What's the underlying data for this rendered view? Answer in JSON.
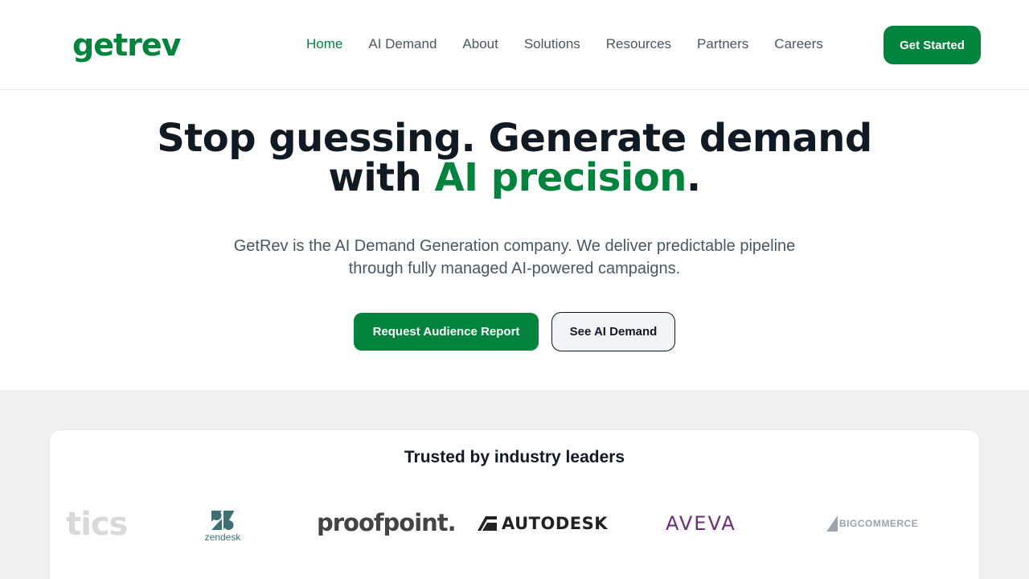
{
  "header": {
    "logo": "getrev",
    "nav": [
      {
        "label": "Home",
        "active": true
      },
      {
        "label": "AI Demand",
        "active": false
      },
      {
        "label": "About",
        "active": false
      },
      {
        "label": "Solutions",
        "active": false
      },
      {
        "label": "Resources",
        "active": false
      },
      {
        "label": "Partners",
        "active": false
      },
      {
        "label": "Careers",
        "active": false
      }
    ],
    "cta_label": "Get Started"
  },
  "hero": {
    "title_line1": "Stop guessing. Generate demand",
    "title_line2_prefix": "with ",
    "title_line2_accent": "AI precision",
    "title_line2_suffix": ".",
    "subtitle": "GetRev is the AI Demand Generation company. We deliver predictable pipeline through fully managed AI-powered campaigns.",
    "primary_button": "Request Audience Report",
    "secondary_button": "See AI Demand"
  },
  "trusted": {
    "heading": "Trusted by industry leaders",
    "logos": [
      "tics",
      "zendesk",
      "proofpoint.",
      "AUTODESK",
      "AVEVA",
      "BIGCOMMERCE"
    ]
  },
  "colors": {
    "brand_green": "#00843d",
    "heading_dark": "#111a22",
    "body_gray": "#4b5563",
    "band_gray": "#f0f0f0"
  }
}
